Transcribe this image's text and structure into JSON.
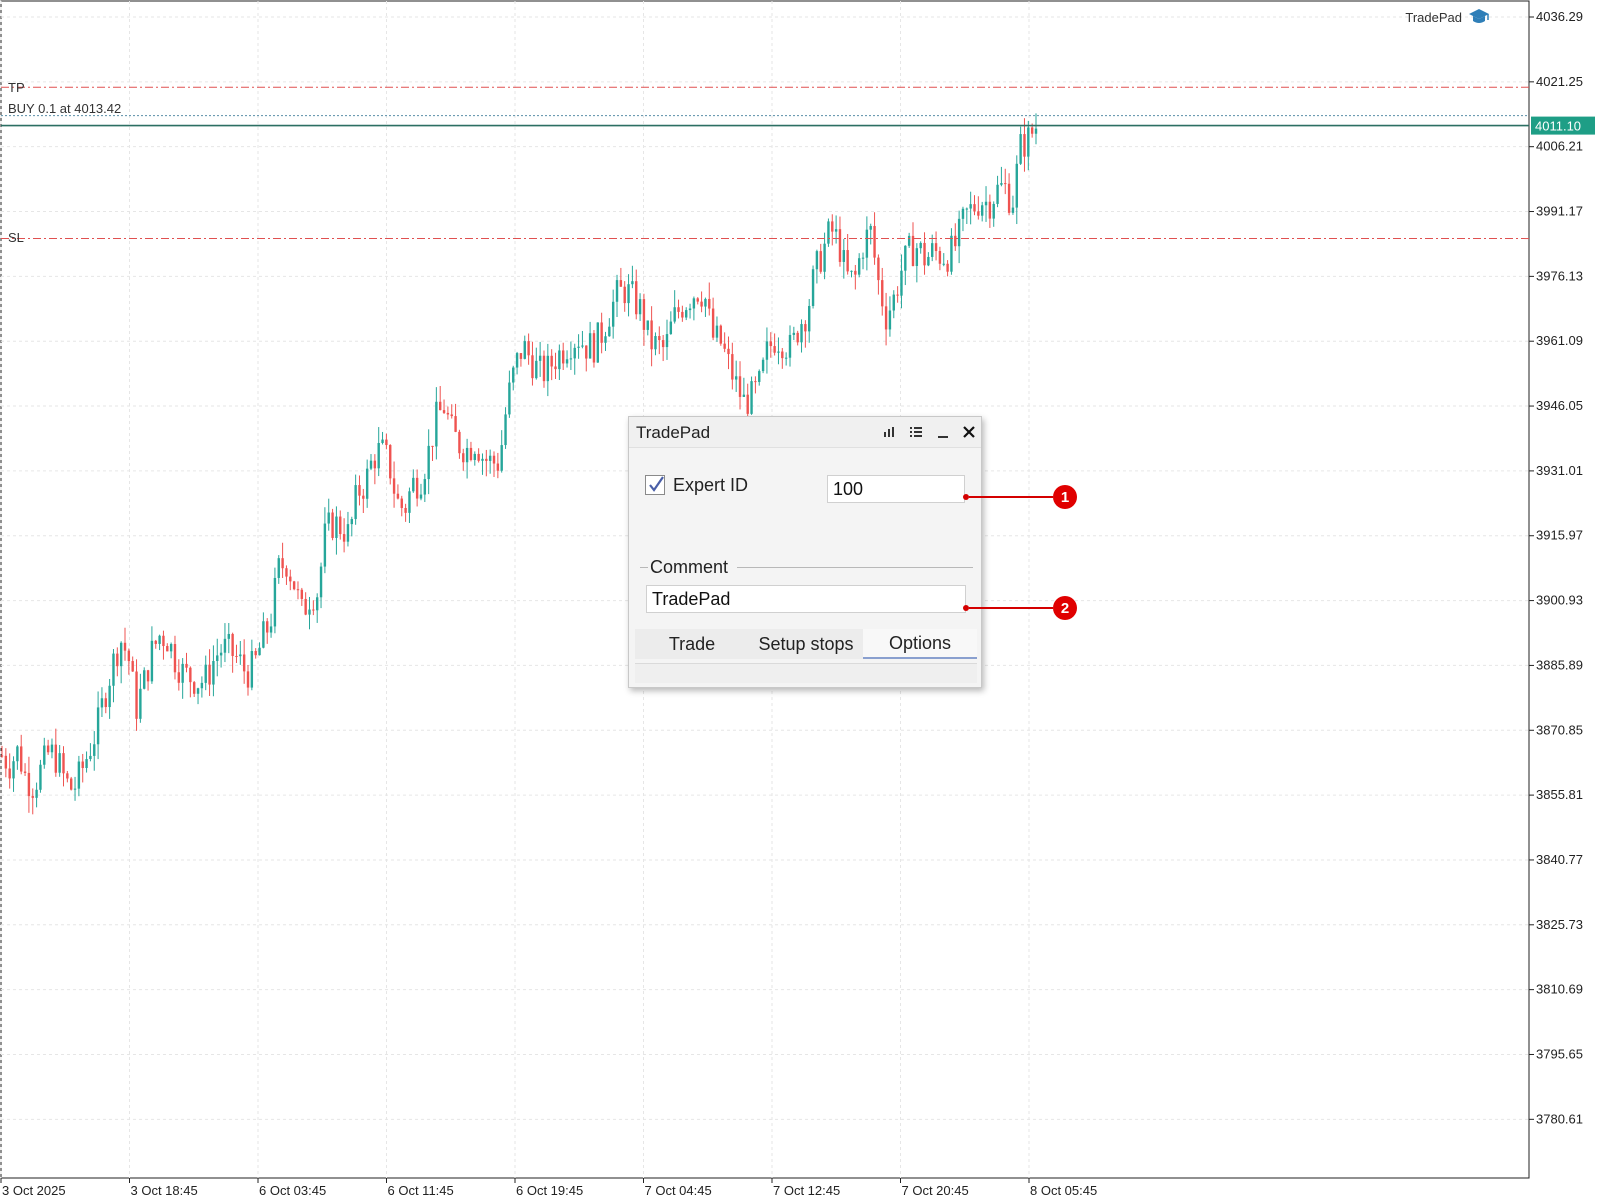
{
  "brand": {
    "label": "TradePad",
    "icon": "graduation-cap-icon"
  },
  "order_lines": {
    "tp": {
      "label": "TP",
      "price": 4020.0,
      "color": "#e05050"
    },
    "buy": {
      "label": "BUY 0.1 at 4013.42",
      "price": 4013.42,
      "color": "#5a8fa8"
    },
    "sl": {
      "label": "SL",
      "price": 3984.9,
      "color": "#e05050"
    }
  },
  "current_price": {
    "label": "4011.10",
    "value": 4011.1,
    "color": "#1e9e86"
  },
  "chart_data": {
    "type": "candlestick",
    "ylim": [
      3767.0,
      4040.0
    ],
    "y_ticks": [
      "4036.29",
      "4021.25",
      "4006.21",
      "3991.17",
      "3976.13",
      "3961.09",
      "3946.05",
      "3931.01",
      "3915.97",
      "3900.93",
      "3885.89",
      "3870.85",
      "3855.81",
      "3840.77",
      "3825.73",
      "3810.69",
      "3795.65",
      "3780.61"
    ],
    "x_ticks": [
      "3 Oct 2025",
      "3 Oct 18:45",
      "6 Oct 03:45",
      "6 Oct 11:45",
      "6 Oct 19:45",
      "7 Oct 04:45",
      "7 Oct 12:45",
      "7 Oct 20:45",
      "8 Oct 05:45"
    ],
    "close_path": [
      3865,
      3863,
      3866,
      3860,
      3858,
      3862,
      3866,
      3864,
      3859,
      3857,
      3861,
      3866,
      3871,
      3879,
      3886,
      3892,
      3888,
      3876,
      3882,
      3889,
      3893,
      3892,
      3887,
      3884,
      3883,
      3882,
      3883,
      3888,
      3890,
      3889,
      3887,
      3884,
      3886,
      3892,
      3896,
      3908,
      3910,
      3905,
      3898,
      3902,
      3903,
      3917,
      3919,
      3918,
      3916,
      3926,
      3928,
      3934,
      3936,
      3933,
      3924,
      3922,
      3928,
      3929,
      3935,
      3943,
      3946,
      3940,
      3937,
      3936,
      3938,
      3934,
      3933,
      3933,
      3947,
      3955,
      3960,
      3957,
      3954,
      3954,
      3957,
      3959,
      3961,
      3962,
      3960,
      3960,
      3963,
      3968,
      3972,
      3973,
      3971,
      3968,
      3961,
      3960,
      3959,
      3966,
      3969,
      3971,
      3973,
      3972,
      3962,
      3961,
      3956,
      3951,
      3947,
      3948,
      3951,
      3959,
      3962,
      3961,
      3959,
      3965,
      3968,
      3977,
      3982,
      3987,
      3984,
      3976,
      3975,
      3983,
      3987,
      3975,
      3967,
      3971,
      3978,
      3982,
      3983,
      3980,
      3982,
      3981,
      3981,
      3984,
      3990,
      3992,
      3994,
      3993,
      3996,
      3997,
      3993,
      4006,
      4008,
      4011
    ]
  },
  "tradepad": {
    "title": "TradePad",
    "expert_id_label": "Expert ID",
    "expert_id_checked": true,
    "expert_id_value": "100",
    "comment_label": "Comment",
    "comment_value": "TradePad",
    "tabs": [
      {
        "label": "Trade",
        "active": false
      },
      {
        "label": "Setup stops",
        "active": false
      },
      {
        "label": "Options",
        "active": true
      }
    ]
  },
  "callouts": [
    {
      "number": "1"
    },
    {
      "number": "2"
    }
  ]
}
